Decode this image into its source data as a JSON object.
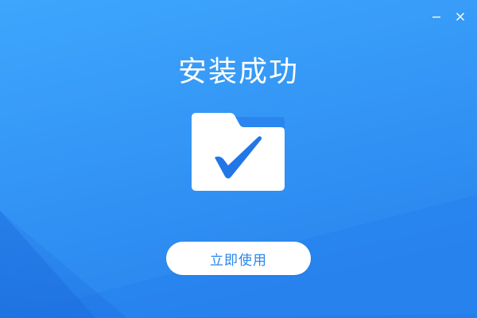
{
  "window": {
    "title": "安装成功",
    "controls": {
      "minimize_icon": "minimize-icon",
      "close_icon": "close-icon"
    }
  },
  "illustration": {
    "icon": "folder-check-icon"
  },
  "actions": {
    "primary_label": "立即使用"
  },
  "colors": {
    "background_top": "#3aa2fb",
    "background_bottom": "#1e72e2",
    "folder_body": "#ffffff",
    "folder_tab": "#2a86ee",
    "check": "#2277e6",
    "button_text": "#2a86ee"
  }
}
